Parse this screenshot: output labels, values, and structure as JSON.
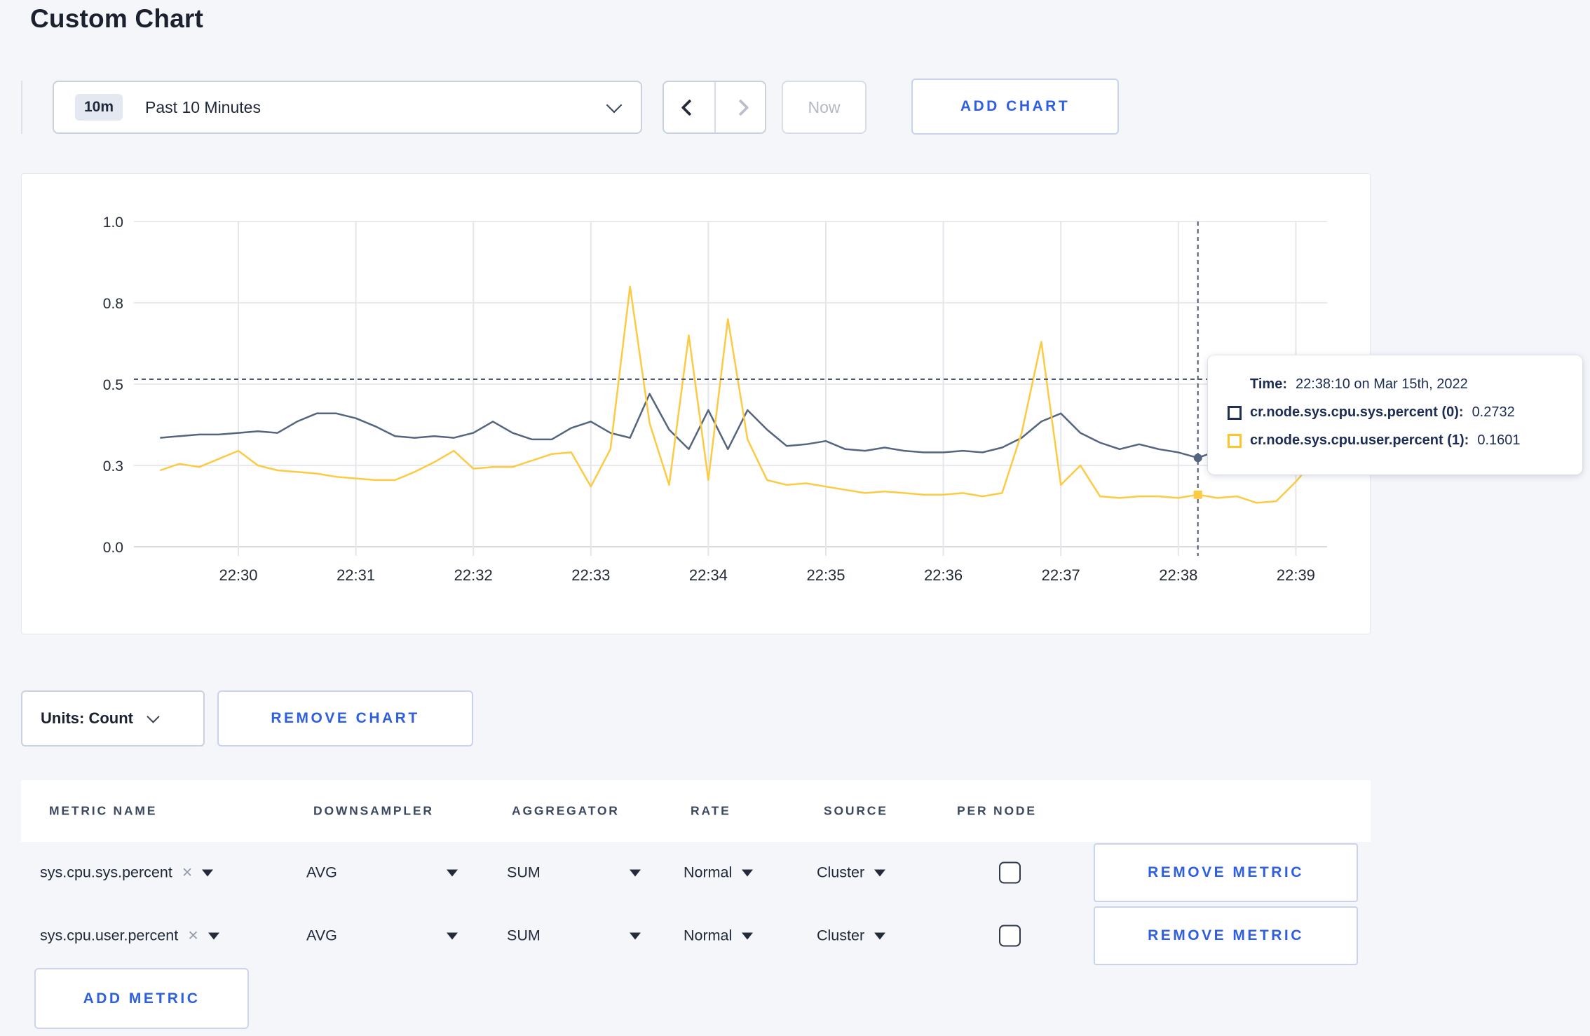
{
  "page": {
    "title": "Custom Chart"
  },
  "toolbar": {
    "time_window_badge": "10m",
    "time_window_label": "Past 10 Minutes",
    "now_label": "Now",
    "add_chart_label": "ADD CHART"
  },
  "chart": {
    "tooltip": {
      "time_label": "Time:",
      "time_value": "22:38:10 on Mar 15th, 2022",
      "series": [
        {
          "name": "cr.node.sys.cpu.sys.percent (0):",
          "value": "0.2732",
          "color": "#1f2f55"
        },
        {
          "name": "cr.node.sys.cpu.user.percent (1):",
          "value": "0.1601",
          "color": "#ffc426"
        }
      ]
    }
  },
  "chart_data": {
    "type": "line",
    "title": "",
    "xlabel": "",
    "ylabel": "",
    "ylim": [
      0,
      1
    ],
    "grid": true,
    "y_ticks": [
      {
        "value": 0,
        "label": "0.0"
      },
      {
        "value": 0.25,
        "label": "0.3"
      },
      {
        "value": 0.5,
        "label": "0.5"
      },
      {
        "value": 0.75,
        "label": "0.8"
      },
      {
        "value": 1,
        "label": "1.0"
      }
    ],
    "x_ticks": [
      {
        "minute": 0,
        "label": "22:30"
      },
      {
        "minute": 1,
        "label": "22:31"
      },
      {
        "minute": 2,
        "label": "22:32"
      },
      {
        "minute": 3,
        "label": "22:33"
      },
      {
        "minute": 4,
        "label": "22:34"
      },
      {
        "minute": 5,
        "label": "22:35"
      },
      {
        "minute": 6,
        "label": "22:36"
      },
      {
        "minute": 7,
        "label": "22:37"
      },
      {
        "minute": 8,
        "label": "22:38"
      },
      {
        "minute": 9,
        "label": "22:39"
      }
    ],
    "x_start": "22:29:20",
    "interval_seconds": 10,
    "series": [
      {
        "name": "cr.node.sys.cpu.sys.percent",
        "color": "#55647f",
        "values": [
          0.335,
          0.34,
          0.345,
          0.345,
          0.35,
          0.355,
          0.35,
          0.385,
          0.41,
          0.41,
          0.395,
          0.37,
          0.34,
          0.335,
          0.34,
          0.335,
          0.35,
          0.385,
          0.35,
          0.33,
          0.33,
          0.365,
          0.385,
          0.35,
          0.335,
          0.47,
          0.36,
          0.3,
          0.42,
          0.3,
          0.42,
          0.36,
          0.31,
          0.315,
          0.325,
          0.3,
          0.295,
          0.305,
          0.295,
          0.29,
          0.29,
          0.295,
          0.29,
          0.305,
          0.335,
          0.385,
          0.41,
          0.35,
          0.32,
          0.3,
          0.315,
          0.3,
          0.29,
          0.2732,
          0.295,
          0.31,
          0.3,
          0.295,
          0.3,
          0.305,
          0.3
        ]
      },
      {
        "name": "cr.node.sys.cpu.user.percent",
        "color": "#fdca44",
        "values": [
          0.235,
          0.255,
          0.245,
          0.27,
          0.295,
          0.25,
          0.235,
          0.23,
          0.225,
          0.215,
          0.21,
          0.205,
          0.205,
          0.23,
          0.26,
          0.295,
          0.24,
          0.245,
          0.245,
          0.265,
          0.285,
          0.29,
          0.185,
          0.3,
          0.8,
          0.38,
          0.19,
          0.65,
          0.205,
          0.7,
          0.33,
          0.205,
          0.19,
          0.195,
          0.185,
          0.175,
          0.165,
          0.17,
          0.165,
          0.16,
          0.16,
          0.165,
          0.155,
          0.165,
          0.35,
          0.63,
          0.19,
          0.25,
          0.155,
          0.15,
          0.155,
          0.155,
          0.15,
          0.1601,
          0.15,
          0.155,
          0.135,
          0.14,
          0.2,
          0.27,
          0.235
        ]
      }
    ],
    "hover": {
      "time": "22:38:10",
      "crosshair_y_value": 0.515,
      "values": [
        0.2732,
        0.1601
      ],
      "crosshair_color": "#4a5a78"
    },
    "legend_position": "tooltip"
  },
  "units": {
    "label": "Units: Count",
    "remove_chart_label": "REMOVE CHART"
  },
  "metrics": {
    "headers": [
      "METRIC NAME",
      "DOWNSAMPLER",
      "AGGREGATOR",
      "RATE",
      "SOURCE",
      "PER NODE"
    ],
    "rows": [
      {
        "name": "sys.cpu.sys.percent",
        "clear_icon": "×",
        "downsampler": "AVG",
        "aggregator": "SUM",
        "rate": "Normal",
        "source": "Cluster",
        "per_node_checked": false,
        "remove_label": "REMOVE METRIC"
      },
      {
        "name": "sys.cpu.user.percent",
        "clear_icon": "×",
        "downsampler": "AVG",
        "aggregator": "SUM",
        "rate": "Normal",
        "source": "Cluster",
        "per_node_checked": false,
        "remove_label": "REMOVE METRIC"
      }
    ],
    "add_metric_label": "ADD METRIC"
  }
}
